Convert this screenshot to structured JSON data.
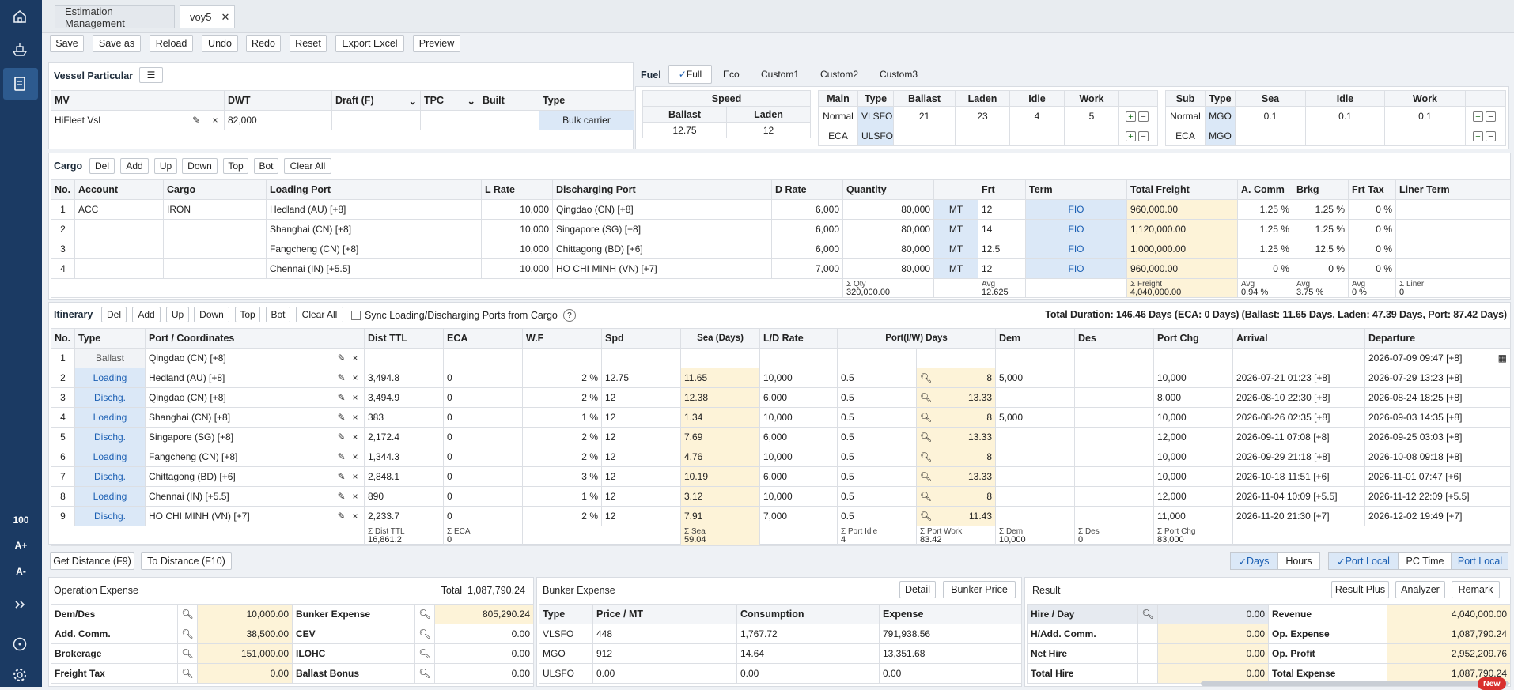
{
  "sidebar": {
    "zoom": "100",
    "font_up": "A+",
    "font_down": "A-"
  },
  "tabs": [
    {
      "label": "Estimation Management"
    },
    {
      "label": "voy5"
    }
  ],
  "toolbar": {
    "save": "Save",
    "save_as": "Save as",
    "reload": "Reload",
    "undo": "Undo",
    "redo": "Redo",
    "reset": "Reset",
    "export_excel": "Export Excel",
    "preview": "Preview"
  },
  "vessel": {
    "title": "Vessel Particular",
    "headers": [
      "MV",
      "DWT",
      "Draft (F)",
      "TPC",
      "Built",
      "Type"
    ],
    "mv": "HiFleet Vsl",
    "dwt": "82,000",
    "draft": "",
    "tpc": "",
    "built": "",
    "type": "Bulk carrier"
  },
  "fuel": {
    "title": "Fuel",
    "tabs": [
      "Full",
      "Eco",
      "Custom1",
      "Custom2",
      "Custom3"
    ],
    "speed": {
      "title": "Speed",
      "headers": [
        "Ballast",
        "Laden"
      ],
      "values": [
        "12.75",
        "12"
      ]
    },
    "main": {
      "headers": [
        "Main",
        "Type",
        "Ballast",
        "Laden",
        "Idle",
        "Work"
      ],
      "rows": [
        [
          "Normal",
          "VLSFO",
          "21",
          "23",
          "4",
          "5"
        ],
        [
          "ECA",
          "ULSFO",
          "",
          "",
          "",
          ""
        ]
      ]
    },
    "sub": {
      "headers": [
        "Sub",
        "Type",
        "Sea",
        "Idle",
        "Work"
      ],
      "rows": [
        [
          "Normal",
          "MGO",
          "0.1",
          "0.1",
          "0.1"
        ],
        [
          "ECA",
          "MGO",
          "",
          "",
          ""
        ]
      ]
    }
  },
  "cargo": {
    "title": "Cargo",
    "buttons": [
      "Del",
      "Add",
      "Up",
      "Down",
      "Top",
      "Bot",
      "Clear All"
    ],
    "headers": [
      "No.",
      "Account",
      "Cargo",
      "Loading Port",
      "L Rate",
      "Discharging Port",
      "D Rate",
      "Quantity",
      "",
      "Frt",
      "Term",
      "Total Freight",
      "A. Comm",
      "Brkg",
      "Frt Tax",
      "Liner Term"
    ],
    "rows": [
      [
        "1",
        "ACC",
        "IRON",
        "Hedland (AU) [+8]",
        "10,000",
        "Qingdao (CN) [+8]",
        "6,000",
        "80,000",
        "MT",
        "12",
        "FIO",
        "960,000.00",
        "1.25",
        "1.25",
        "0",
        ""
      ],
      [
        "2",
        "",
        "",
        "Shanghai (CN) [+8]",
        "10,000",
        "Singapore (SG) [+8]",
        "6,000",
        "80,000",
        "MT",
        "14",
        "FIO",
        "1,120,000.00",
        "1.25",
        "1.25",
        "0",
        ""
      ],
      [
        "3",
        "",
        "",
        "Fangcheng (CN) [+8]",
        "10,000",
        "Chittagong (BD) [+6]",
        "6,000",
        "80,000",
        "MT",
        "12.5",
        "FIO",
        "1,000,000.00",
        "1.25",
        "12.5",
        "0",
        ""
      ],
      [
        "4",
        "",
        "",
        "Chennai (IN) [+5.5]",
        "10,000",
        "HO CHI MINH (VN) [+7]",
        "7,000",
        "80,000",
        "MT",
        "12",
        "FIO",
        "960,000.00",
        "0",
        "0",
        "0",
        ""
      ]
    ],
    "summary": {
      "qty_label": "Σ Qty",
      "qty": "320,000.00",
      "frt_label": "Avg",
      "frt": "12.625",
      "freight_label": "Σ Freight",
      "freight": "4,040,000.00",
      "comm_label": "Avg",
      "comm": "0.94 %",
      "brkg_label": "Avg",
      "brkg": "3.75 %",
      "tax_label": "Avg",
      "tax": "0 %",
      "liner_label": "Σ Liner",
      "liner": "0"
    }
  },
  "itinerary": {
    "title": "Itinerary",
    "buttons": [
      "Del",
      "Add",
      "Up",
      "Down",
      "Top",
      "Bot",
      "Clear All"
    ],
    "sync_label": "Sync Loading/Discharging Ports from Cargo",
    "help": "?",
    "total_duration": "Total Duration: 146.46 Days (ECA: 0 Days) (Ballast: 11.65 Days, Laden: 47.39 Days, Port: 87.42 Days)",
    "headers": [
      "No.",
      "Type",
      "Port / Coordinates",
      "Dist TTL",
      "ECA",
      "W.F",
      "Spd",
      "Sea (Days)",
      "L/D Rate",
      "Port(I/W) Days",
      "Dem",
      "Des",
      "Port Chg",
      "Arrival",
      "Departure"
    ],
    "rows": [
      [
        "1",
        "Ballast",
        "Qingdao (CN) [+8]",
        "",
        "",
        "",
        "",
        "",
        "",
        "",
        "",
        "",
        "",
        "",
        "",
        "2026-07-09 09:47 [+8]"
      ],
      [
        "2",
        "Loading",
        "Hedland (AU) [+8]",
        "3,494.8",
        "0",
        "2",
        "12.75",
        "11.65",
        "10,000",
        "0.5",
        "8",
        "5,000",
        "",
        "10,000",
        "2026-07-21 01:23 [+8]",
        "2026-07-29 13:23 [+8]"
      ],
      [
        "3",
        "Dischg.",
        "Qingdao (CN) [+8]",
        "3,494.9",
        "0",
        "2",
        "12",
        "12.38",
        "6,000",
        "0.5",
        "13.33",
        "",
        "",
        "8,000",
        "2026-08-10 22:30 [+8]",
        "2026-08-24 18:25 [+8]"
      ],
      [
        "4",
        "Loading",
        "Shanghai (CN) [+8]",
        "383",
        "0",
        "1",
        "12",
        "1.34",
        "10,000",
        "0.5",
        "8",
        "5,000",
        "",
        "10,000",
        "2026-08-26 02:35 [+8]",
        "2026-09-03 14:35 [+8]"
      ],
      [
        "5",
        "Dischg.",
        "Singapore (SG) [+8]",
        "2,172.4",
        "0",
        "2",
        "12",
        "7.69",
        "6,000",
        "0.5",
        "13.33",
        "",
        "",
        "12,000",
        "2026-09-11 07:08 [+8]",
        "2026-09-25 03:03 [+8]"
      ],
      [
        "6",
        "Loading",
        "Fangcheng (CN) [+8]",
        "1,344.3",
        "0",
        "2",
        "12",
        "4.76",
        "10,000",
        "0.5",
        "8",
        "",
        "",
        "10,000",
        "2026-09-29 21:18 [+8]",
        "2026-10-08 09:18 [+8]"
      ],
      [
        "7",
        "Dischg.",
        "Chittagong (BD) [+6]",
        "2,848.1",
        "0",
        "3",
        "12",
        "10.19",
        "6,000",
        "0.5",
        "13.33",
        "",
        "",
        "10,000",
        "2026-10-18 11:51 [+6]",
        "2026-11-01 07:47 [+6]"
      ],
      [
        "8",
        "Loading",
        "Chennai (IN) [+5.5]",
        "890",
        "0",
        "1",
        "12",
        "3.12",
        "10,000",
        "0.5",
        "8",
        "",
        "",
        "12,000",
        "2026-11-04 10:09 [+5.5]",
        "2026-11-12 22:09 [+5.5]"
      ],
      [
        "9",
        "Dischg.",
        "HO CHI MINH (VN) [+7]",
        "2,233.7",
        "0",
        "2",
        "12",
        "7.91",
        "7,000",
        "0.5",
        "11.43",
        "",
        "",
        "11,000",
        "2026-11-20 21:30 [+7]",
        "2026-12-02 19:49 [+7]"
      ]
    ],
    "summary": {
      "dist_label": "Σ Dist TTL",
      "dist": "16,861.2",
      "eca_label": "Σ ECA",
      "eca": "0",
      "sea_label": "Σ Sea",
      "sea": "59.04",
      "idle_label": "Σ Port Idle",
      "idle": "4",
      "work_label": "Σ Port Work",
      "work": "83.42",
      "dem_label": "Σ Dem",
      "dem": "10,000",
      "des_label": "Σ Des",
      "des": "0",
      "chg_label": "Σ Port Chg",
      "chg": "83,000"
    }
  },
  "distance": {
    "get": "Get Distance (F9)",
    "to": "To Distance (F10)"
  },
  "toggles": {
    "days": "Days",
    "hours": "Hours",
    "port_local": "Port Local",
    "pc_time": "PC Time",
    "port_local2": "Port Local"
  },
  "opex": {
    "title": "Operation Expense",
    "total_label": "Total",
    "total": "1,087,790.24",
    "left": [
      [
        "Dem/Des",
        "10,000.00"
      ],
      [
        "Add. Comm.",
        "38,500.00"
      ],
      [
        "Brokerage",
        "151,000.00"
      ],
      [
        "Freight Tax",
        "0.00"
      ]
    ],
    "right": [
      [
        "Bunker Expense",
        "805,290.24"
      ],
      [
        "CEV",
        "0.00"
      ],
      [
        "ILOHC",
        "0.00"
      ],
      [
        "Ballast Bonus",
        "0.00"
      ]
    ]
  },
  "bunker": {
    "title": "Bunker Expense",
    "detail": "Detail",
    "price": "Bunker Price",
    "headers": [
      "Type",
      "Price / MT",
      "Consumption",
      "Expense"
    ],
    "rows": [
      [
        "VLSFO",
        "448",
        "1,767.72",
        "791,938.56"
      ],
      [
        "MGO",
        "912",
        "14.64",
        "13,351.68"
      ],
      [
        "ULSFO",
        "0.00",
        "0.00",
        "0.00"
      ]
    ]
  },
  "result": {
    "title": "Result",
    "plus": "Result Plus",
    "analyzer": "Analyzer",
    "remark": "Remark",
    "left": [
      [
        "Hire / Day",
        "0.00"
      ],
      [
        "H/Add. Comm.",
        "0.00"
      ],
      [
        "Net Hire",
        "0.00"
      ],
      [
        "Total Hire",
        "0.00"
      ]
    ],
    "right": [
      [
        "Revenue",
        "4,040,000.00"
      ],
      [
        "Op. Expense",
        "1,087,790.24"
      ],
      [
        "Op. Profit",
        "2,952,209.76"
      ],
      [
        "Total Expense",
        "1,087,790.24"
      ]
    ],
    "new_badge": "New"
  }
}
